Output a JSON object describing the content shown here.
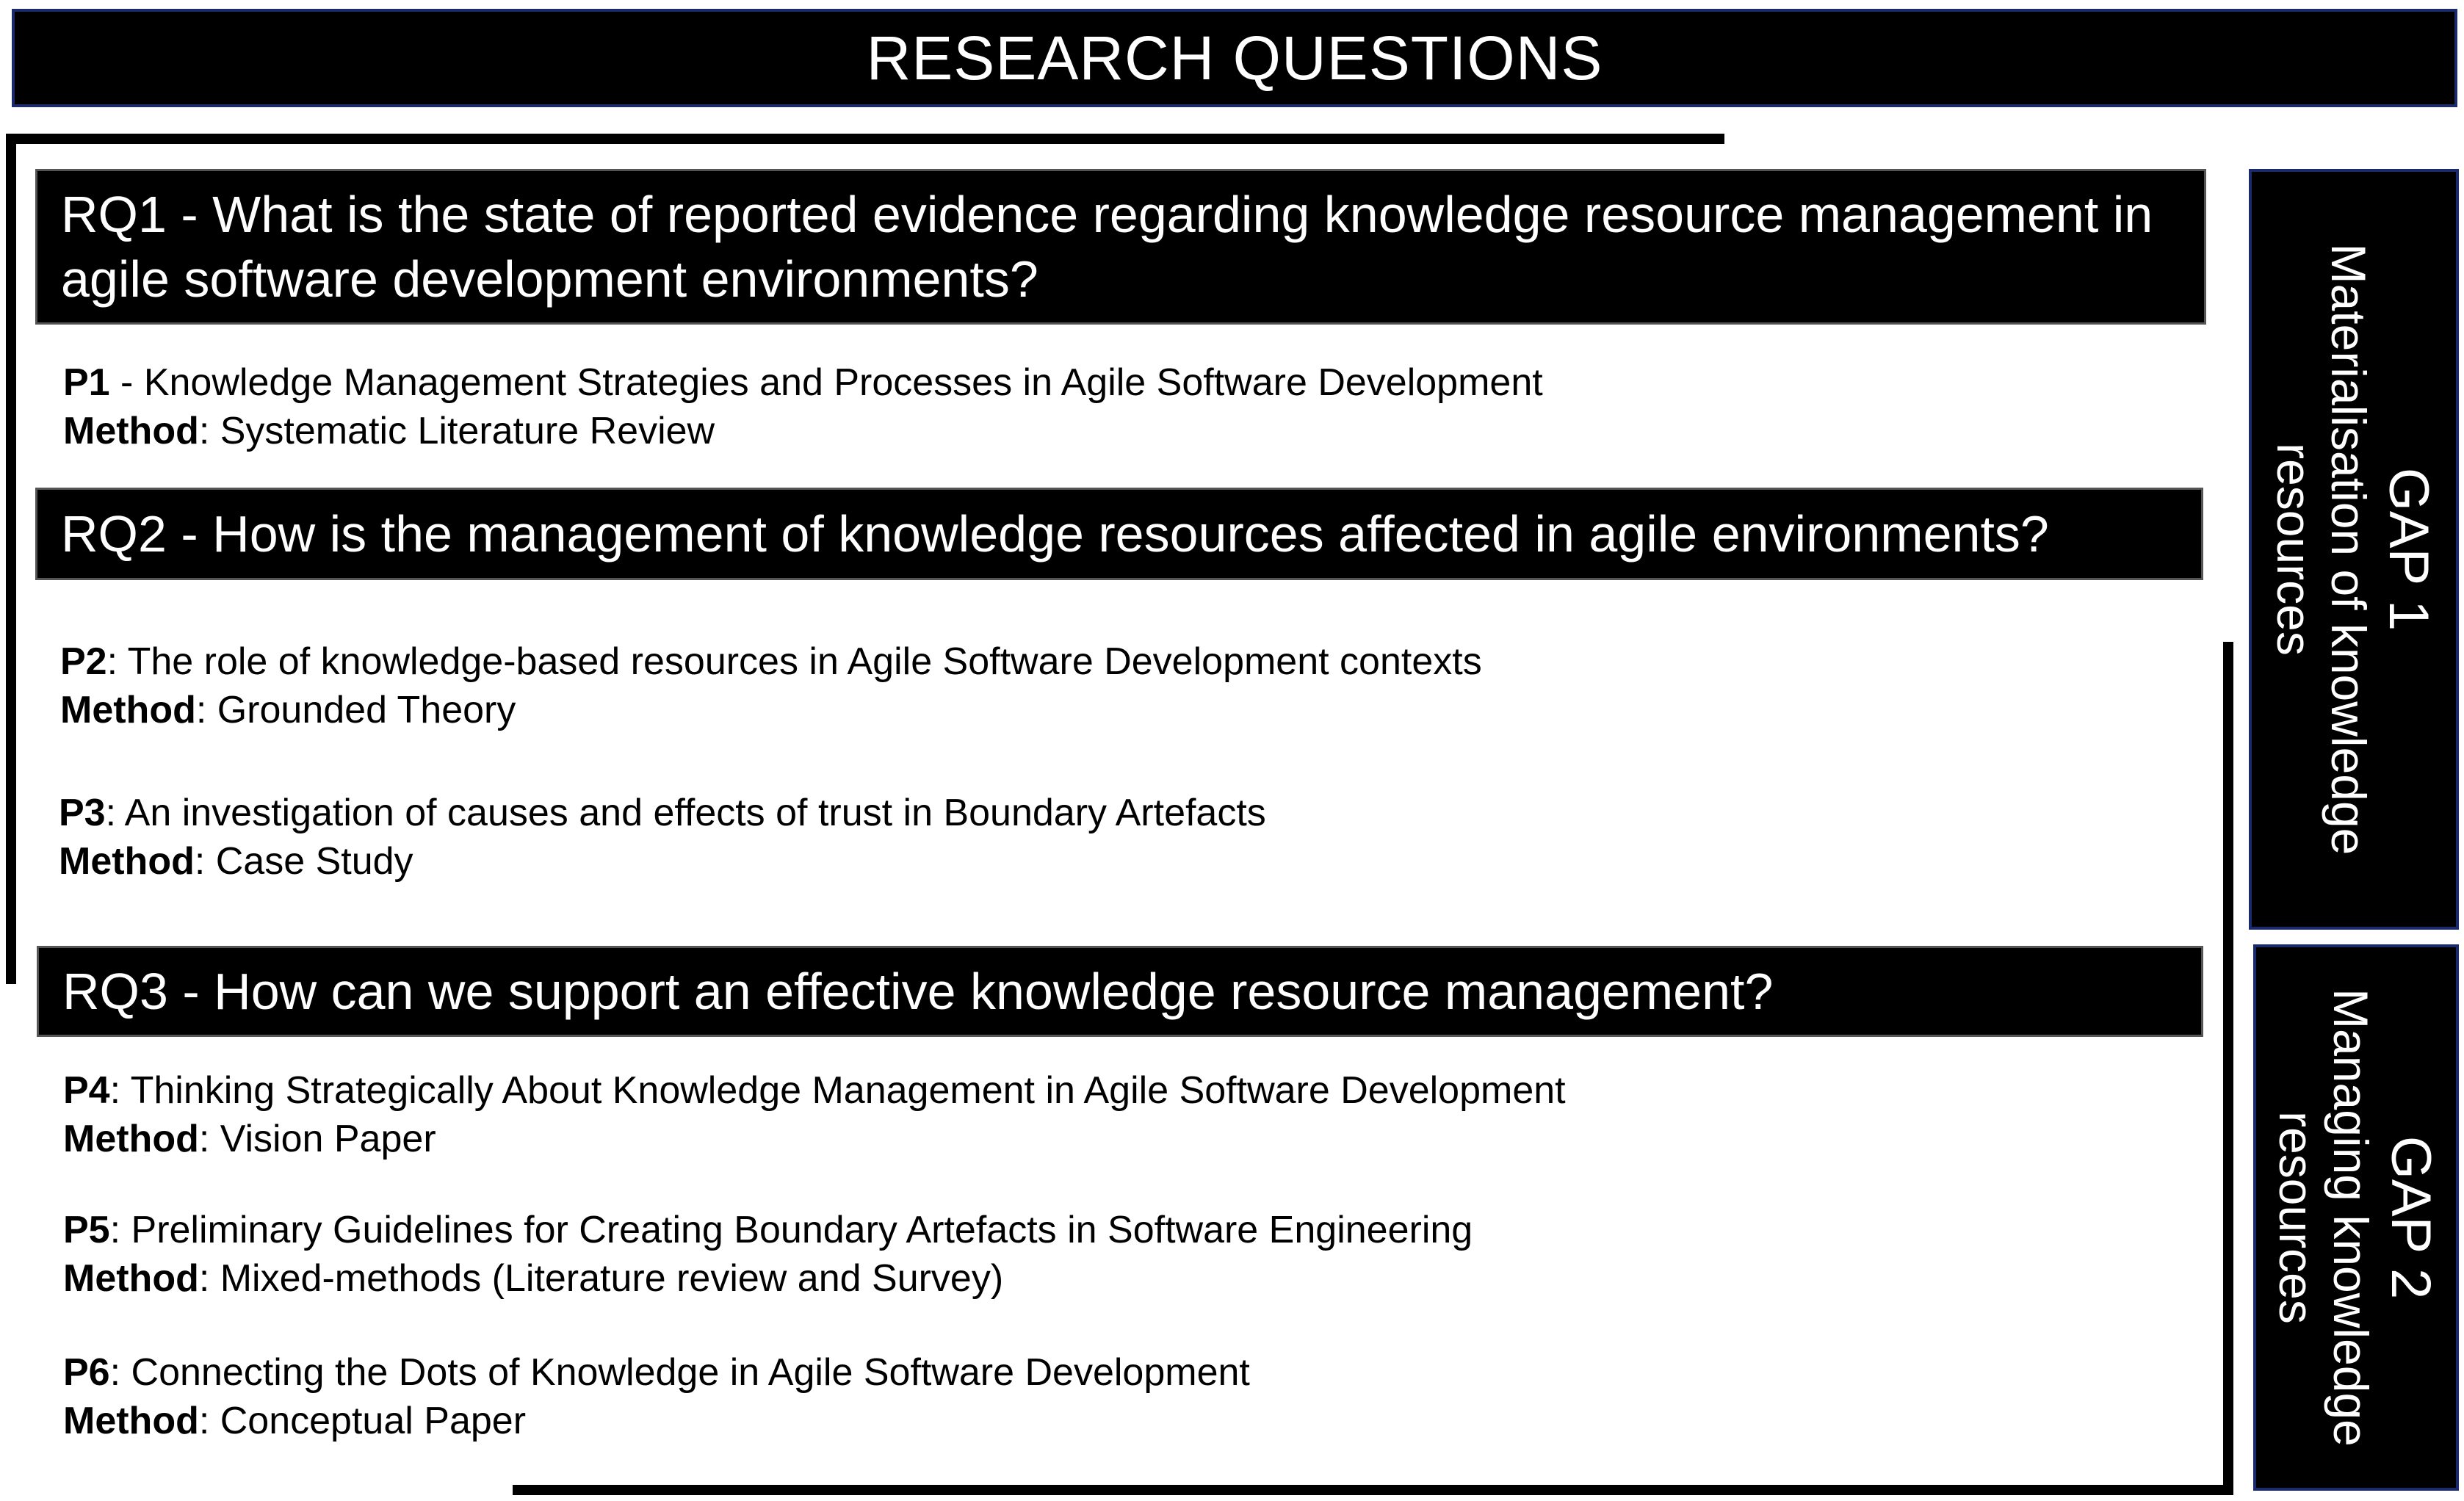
{
  "title": "RESEARCH QUESTIONS",
  "research_questions": [
    {
      "label": "RQ1 - What is the state of reported evidence regarding knowledge resource management in agile software development environments?",
      "papers": [
        {
          "code": "P1",
          "sep": " - ",
          "title": "Knowledge Management Strategies and Processes in Agile Software Development",
          "method_label": "Method",
          "method": ": Systematic Literature Review"
        }
      ]
    },
    {
      "label": "RQ2 - How is the management of knowledge resources affected in agile environments?",
      "papers": [
        {
          "code": "P2",
          "sep": ": ",
          "title": "The role of knowledge-based resources in Agile Software Development contexts",
          "method_label": "Method",
          "method": ": Grounded Theory"
        },
        {
          "code": "P3",
          "sep": ": ",
          "title": "An investigation of causes and effects of trust in Boundary Artefacts",
          "method_label": "Method",
          "method": ": Case Study"
        }
      ]
    },
    {
      "label": "RQ3 - How can we support an effective knowledge resource management?",
      "papers": [
        {
          "code": "P4",
          "sep": ": ",
          "title": "Thinking Strategically About Knowledge Management in Agile Software Development",
          "method_label": "Method",
          "method": ": Vision Paper"
        },
        {
          "code": "P5",
          "sep": ": ",
          "title": "Preliminary Guidelines for Creating Boundary Artefacts in Software Engineering",
          "method_label": "Method",
          "method": ": Mixed-methods (Literature review and Survey)"
        },
        {
          "code": "P6",
          "sep": ": ",
          "title": "Connecting the Dots of Knowledge in Agile Software Development",
          "method_label": "Method",
          "method": ": Conceptual Paper"
        }
      ]
    }
  ],
  "gaps": [
    {
      "title": "GAP 1",
      "line1": "Materialisation of knowledge",
      "line2": "resources"
    },
    {
      "title": "GAP 2",
      "line1": "Managing knowledge",
      "line2": "resources"
    }
  ]
}
